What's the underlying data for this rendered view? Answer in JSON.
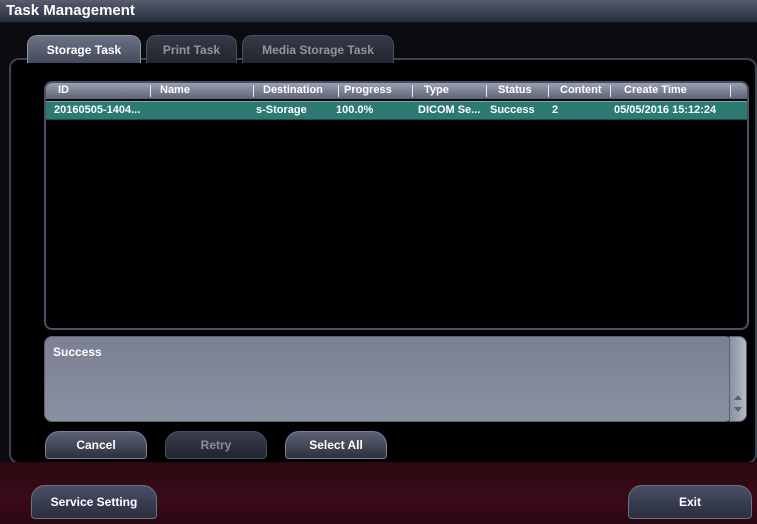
{
  "window": {
    "title": "Task Management"
  },
  "tabs": [
    {
      "label": "Storage Task",
      "active": true
    },
    {
      "label": "Print Task",
      "active": false
    },
    {
      "label": "Media Storage Task",
      "active": false
    }
  ],
  "table": {
    "columns": [
      "ID",
      "Name",
      "Destination",
      "Progress",
      "Type",
      "Status",
      "Content",
      "Create Time"
    ],
    "rows": [
      {
        "id": "20160505-1404...",
        "name": "",
        "destination": "s-Storage",
        "progress": "100.0%",
        "type": "DICOM Se...",
        "status": "Success",
        "content": "2",
        "create_time": "05/05/2016 15:12:24"
      }
    ]
  },
  "message": {
    "text": "Success"
  },
  "buttons": {
    "cancel": "Cancel",
    "retry": "Retry",
    "select_all": "Select All"
  },
  "footer": {
    "service_setting": "Service Setting",
    "exit": "Exit"
  },
  "colors": {
    "selected_row": "#2d7a73",
    "header": "#6e7587",
    "footer_bg": "#3a0a18"
  }
}
